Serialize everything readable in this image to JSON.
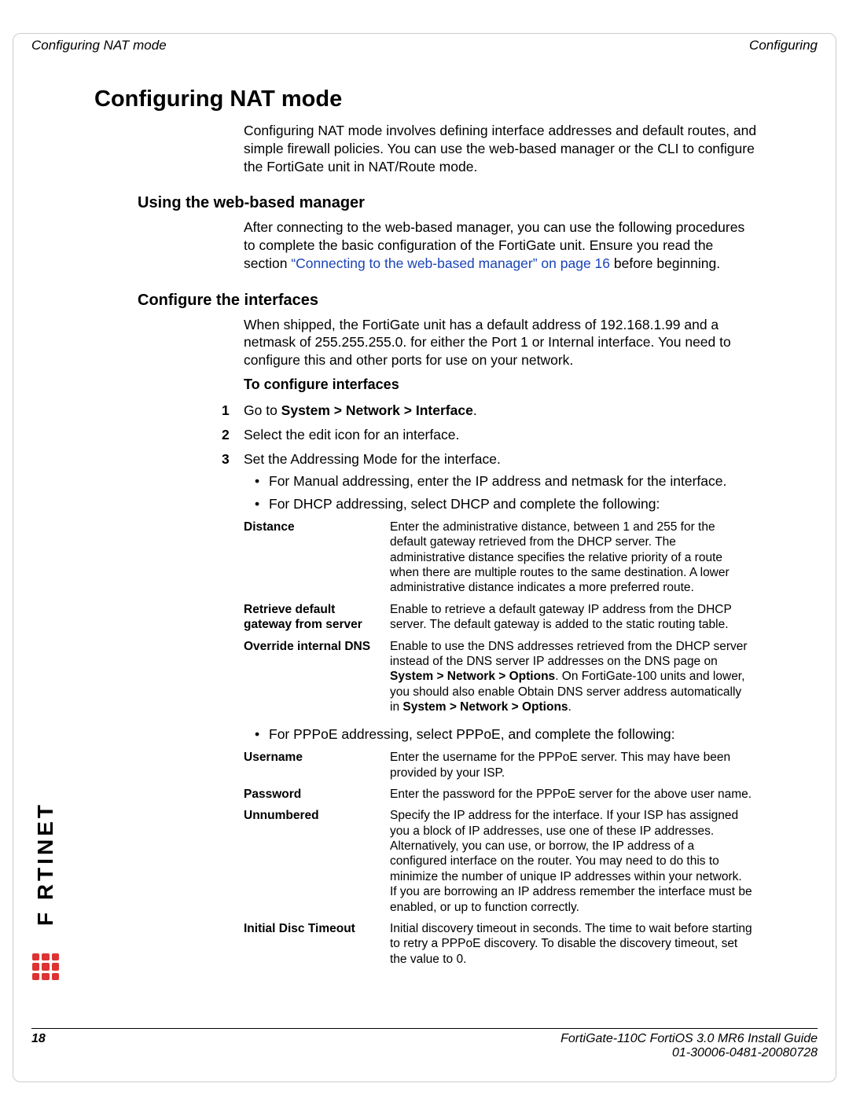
{
  "runningHead": {
    "left": "Configuring NAT mode",
    "right": "Configuring"
  },
  "title": "Configuring NAT mode",
  "intro": "Configuring NAT mode involves defining interface addresses and default routes, and simple firewall policies. You can use the web-based manager or the CLI to configure the FortiGate unit in NAT/Route mode.",
  "sec1": {
    "heading": "Using the web-based manager",
    "p1_a": "After connecting to the web-based manager, you can use the following procedures to complete the basic configuration of the FortiGate unit. Ensure you read the section ",
    "p1_link": "“Connecting to the web-based manager” on page 16",
    "p1_b": " before beginning."
  },
  "sec2": {
    "heading": "Configure the interfaces",
    "p1": "When shipped, the FortiGate unit has a default address of 192.168.1.99 and a netmask of 255.255.255.0. for either the Port 1 or Internal interface. You need to configure this and other ports for use on your network.",
    "h3": "To configure interfaces",
    "step1_a": "Go to ",
    "step1_b": "System > Network > Interface",
    "step1_c": ".",
    "step2": "Select the edit icon for an interface.",
    "step3": "Set the Addressing Mode for the interface.",
    "s3_b1": "For Manual addressing, enter the IP address and netmask for the interface.",
    "s3_b2": "For DHCP addressing, select DHCP and complete the following:",
    "dhcp": {
      "r1": {
        "label": "Distance",
        "desc": "Enter the administrative distance, between 1 and 255 for the default gateway retrieved from the DHCP server. The administrative distance specifies the relative priority of a route when there are multiple routes to the same destination. A lower administrative distance indicates a more preferred route."
      },
      "r2": {
        "label": "Retrieve default gateway from server",
        "desc": "Enable to retrieve a default gateway IP address from the DHCP server. The default gateway is added to the static routing table."
      },
      "r3": {
        "label": "Override internal DNS",
        "desc_a": "Enable to use the DNS addresses retrieved from the DHCP server instead of the DNS server IP addresses on the DNS page on ",
        "desc_b": "System > Network > Options",
        "desc_c": ". On FortiGate-100 units and lower, you should also enable Obtain DNS server address automatically in ",
        "desc_d": "System > Network > Options",
        "desc_e": "."
      }
    },
    "s3_b3": "For PPPoE addressing, select PPPoE, and complete the following:",
    "pppoe": {
      "r1": {
        "label": "Username",
        "desc": "Enter the username for the PPPoE server. This may have been provided by your ISP."
      },
      "r2": {
        "label": "Password",
        "desc": "Enter the password for the PPPoE server for the above user name."
      },
      "r3": {
        "label": "Unnumbered",
        "d1": "Specify the IP address for the interface. If your ISP has assigned you a block of IP addresses, use one of these IP addresses. Alternatively, you can use, or borrow, the IP address of a configured interface on the router. You may need to do this to minimize the number of unique IP addresses within your network.",
        "d2": "If you are borrowing an IP address remember the interface must be enabled, or up to function correctly."
      },
      "r4": {
        "label": "Initial Disc Timeout",
        "desc": "Initial discovery timeout in seconds. The time to wait before starting to retry a PPPoE discovery. To disable the discovery timeout, set the value to 0."
      }
    }
  },
  "footer": {
    "page": "18",
    "doc": "FortiGate-110C FortiOS 3.0 MR6 Install Guide",
    "num": "01-30006-0481-20080728"
  },
  "logo": "F   RTINET"
}
